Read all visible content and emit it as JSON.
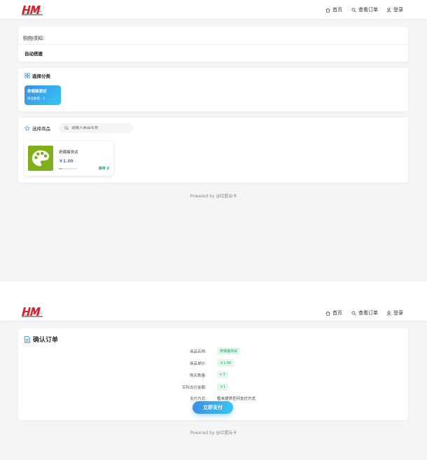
{
  "nav": {
    "home": "首页",
    "orders": "查看订单",
    "login": "登录"
  },
  "notice": {
    "title": "购物须知:",
    "body": "自动搭建"
  },
  "category": {
    "section_title": "选择分类",
    "items": [
      {
        "name": "奇偶猫测试",
        "count_text": "商品数量：1"
      }
    ]
  },
  "goods": {
    "section_title": "选择商品",
    "search_placeholder": "请输入商品名称",
    "items": [
      {
        "name": "奇偶猫测试",
        "price": "￥1.00",
        "stock": "库存 2",
        "stock_fraction": 0.2
      }
    ]
  },
  "footer": "Powered by @红盟云卡",
  "order": {
    "title": "确认订单",
    "rows": [
      {
        "label": "商品名称:",
        "value": "奇偶猫测试"
      },
      {
        "label": "商品单价:",
        "value": "￥1.00"
      },
      {
        "label": "购买数量:",
        "value": "x 1"
      },
      {
        "label": "实际支付金额:",
        "value": "￥1"
      },
      {
        "label": "支付方式:",
        "value": "暂未提供任何支付方式"
      }
    ],
    "pay_button": "立即支付"
  },
  "colors": {
    "accent_gradient_start": "#3a8ee6",
    "accent_gradient_end": "#36c6f4",
    "stock_green": "#19a15f",
    "price_blue": "#3a7bd5",
    "logo_red": "#d9232e"
  }
}
